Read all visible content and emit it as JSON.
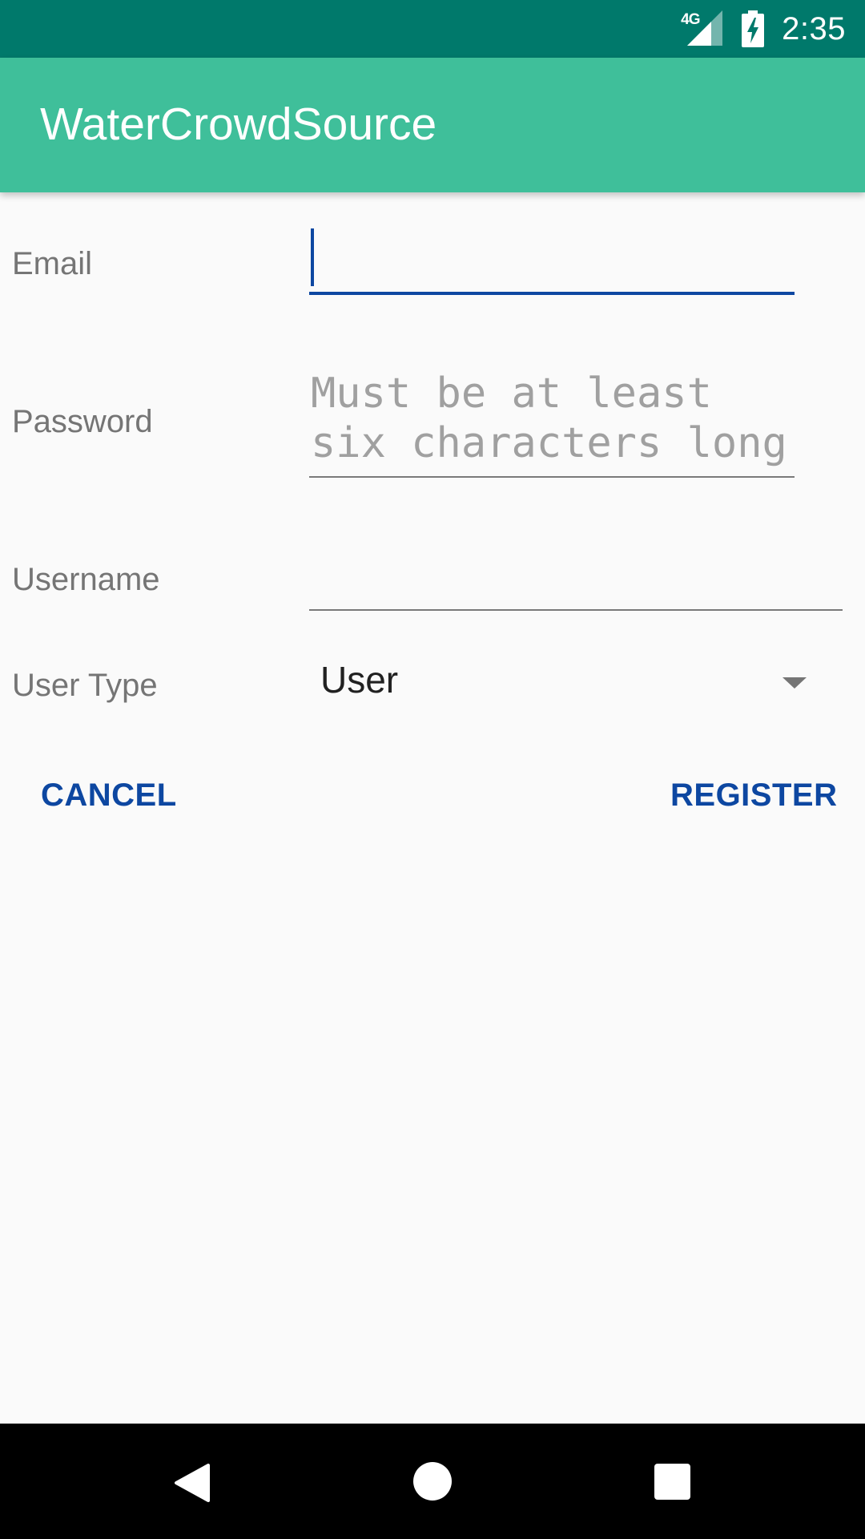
{
  "status_bar": {
    "network": "4G",
    "time": "2:35"
  },
  "app_bar": {
    "title": "WaterCrowdSource"
  },
  "form": {
    "email": {
      "label": "Email",
      "value": ""
    },
    "password": {
      "label": "Password",
      "placeholder": "Must be at least\nsix characters long",
      "value": ""
    },
    "username": {
      "label": "Username",
      "value": ""
    },
    "user_type": {
      "label": "User Type",
      "selected": "User"
    }
  },
  "actions": {
    "cancel_label": "CANCEL",
    "register_label": "REGISTER"
  },
  "colors": {
    "status_bar": "#00796b",
    "app_bar": "#3fbf9a",
    "accent": "#0d47a1"
  },
  "icons": {
    "signal": "cell-signal-icon",
    "battery": "battery-charging-icon",
    "back": "nav-back-icon",
    "home": "nav-home-icon",
    "recents": "nav-recents-icon"
  }
}
